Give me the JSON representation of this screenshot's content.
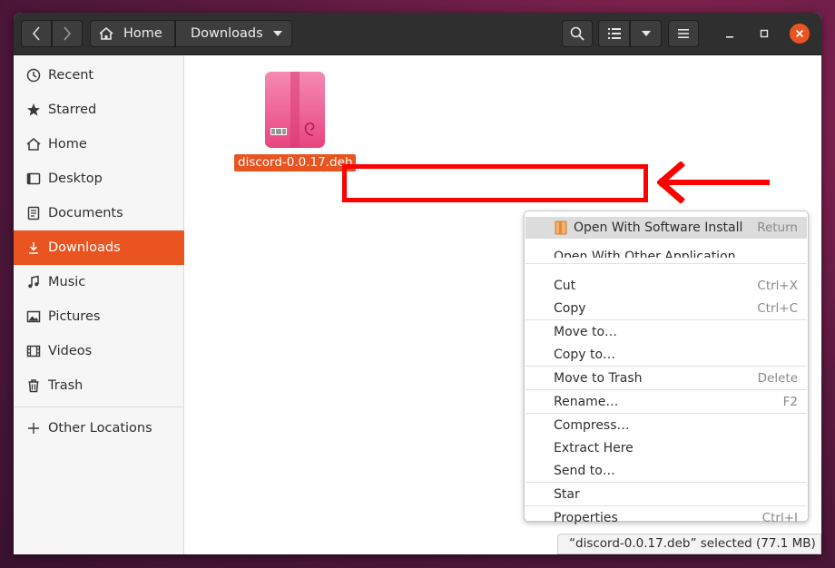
{
  "colors": {
    "accent": "#e95420",
    "highlight_box": "#ff0000",
    "headerbar": "#2f2f2f",
    "close_button": "#e95420"
  },
  "headerbar": {
    "back_icon": "chevron-left-icon",
    "forward_icon": "chevron-right-icon",
    "breadcrumbs": [
      "Home",
      "Downloads"
    ],
    "home_icon": "home-icon",
    "search_icon": "search-icon",
    "view_icon": "list-view-icon",
    "view_dropdown_icon": "chevron-down-icon",
    "menu_icon": "hamburger-menu-icon"
  },
  "sidebar": {
    "items": [
      {
        "label": "Recent",
        "icon": "clock-icon"
      },
      {
        "label": "Starred",
        "icon": "star-icon"
      },
      {
        "label": "Home",
        "icon": "home-icon"
      },
      {
        "label": "Desktop",
        "icon": "desktop-icon"
      },
      {
        "label": "Documents",
        "icon": "document-icon"
      },
      {
        "label": "Downloads",
        "icon": "download-icon",
        "active": true
      },
      {
        "label": "Music",
        "icon": "music-icon"
      },
      {
        "label": "Pictures",
        "icon": "picture-icon"
      },
      {
        "label": "Videos",
        "icon": "video-icon"
      },
      {
        "label": "Trash",
        "icon": "trash-icon"
      }
    ],
    "other_locations": {
      "label": "Other Locations",
      "icon": "plus-icon"
    }
  },
  "files": [
    {
      "name": "discord-0.0.17.deb",
      "icon": "debian-package-icon",
      "selected": true
    }
  ],
  "context_menu": {
    "items": [
      {
        "label": "Open With Software Install",
        "accel": "Return",
        "icon": "software-install-icon",
        "highlighted": true
      },
      {
        "label": "Open With Other Application",
        "accel": ""
      },
      {
        "label": "Cut",
        "accel": "Ctrl+X"
      },
      {
        "label": "Copy",
        "accel": "Ctrl+C"
      },
      {
        "label": "Move to…",
        "accel": ""
      },
      {
        "label": "Copy to…",
        "accel": ""
      },
      {
        "label": "Move to Trash",
        "accel": "Delete"
      },
      {
        "label": "Rename…",
        "accel": "F2"
      },
      {
        "label": "Compress…",
        "accel": ""
      },
      {
        "label": "Extract Here",
        "accel": ""
      },
      {
        "label": "Send to…",
        "accel": ""
      },
      {
        "label": "Star",
        "accel": ""
      },
      {
        "label": "Properties",
        "accel": "Ctrl+I"
      }
    ]
  },
  "statusbar": {
    "text": "“discord-0.0.17.deb” selected  (77.1 MB)"
  },
  "annotation": {
    "arrow_icon": "left-arrow-icon"
  }
}
